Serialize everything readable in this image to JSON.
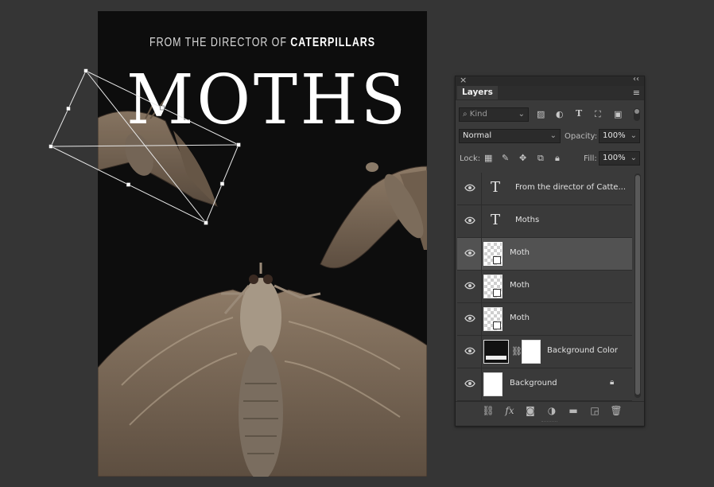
{
  "poster": {
    "tagline_prefix": "FROM THE DIRECTOR OF ",
    "tagline_bold": "CATERPILLARS",
    "title": "MOTHS"
  },
  "panel": {
    "tab": "Layers",
    "filter": {
      "kind_label": "Kind",
      "icons": [
        "image-filter-icon",
        "adjustment-filter-icon",
        "type-filter-icon",
        "shape-filter-icon",
        "smart-object-filter-icon"
      ]
    },
    "blend_mode": "Normal",
    "opacity_label": "Opacity:",
    "opacity_value": "100%",
    "lock_label": "Lock:",
    "fill_label": "Fill:",
    "fill_value": "100%",
    "layers": [
      {
        "name": "From the director of Catte...",
        "kind": "text",
        "visible": true,
        "selected": false
      },
      {
        "name": "Moths",
        "kind": "text",
        "visible": true,
        "selected": false
      },
      {
        "name": "Moth",
        "kind": "smart",
        "visible": true,
        "selected": true
      },
      {
        "name": "Moth",
        "kind": "smart",
        "visible": true,
        "selected": false
      },
      {
        "name": "Moth",
        "kind": "smart",
        "visible": true,
        "selected": false
      },
      {
        "name": "Background Color",
        "kind": "fill-mask",
        "visible": true,
        "selected": false
      },
      {
        "name": "Background",
        "kind": "background",
        "visible": true,
        "selected": false,
        "locked": true
      }
    ],
    "footer_icons": [
      "link-layers-icon",
      "fx-icon",
      "add-mask-icon",
      "adjustment-layer-icon",
      "new-group-icon",
      "new-layer-icon",
      "delete-layer-icon"
    ]
  },
  "colors": {
    "canvas_bg": "#0d0d0d",
    "ui_bg": "#353535",
    "panel_bg": "#3a3a3a",
    "selected_row": "#525252"
  }
}
